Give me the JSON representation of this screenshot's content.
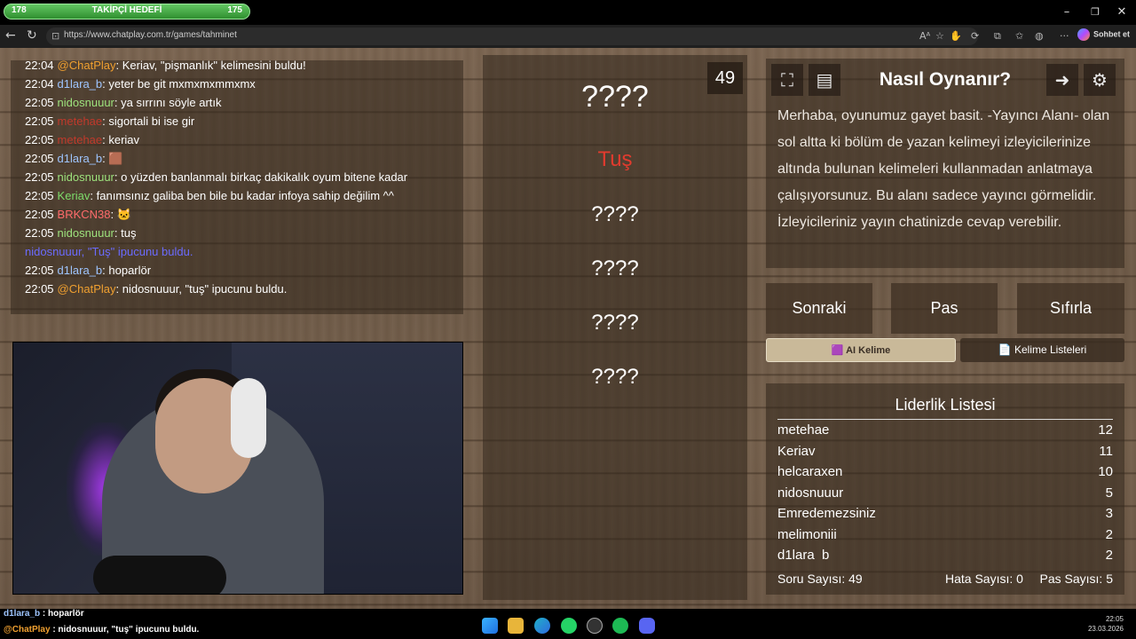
{
  "browser": {
    "url": "https://www.chatplay.com.tr/games/tahminet",
    "chat_button": "Sohbet et"
  },
  "goal": {
    "title": "TAKİPÇİ HEDEFİ",
    "current": "178",
    "target": "175",
    "progress_fraction": 1.0
  },
  "chat": {
    "messages": [
      {
        "time": "22:04",
        "user": "@ChatPlay",
        "user_color": "#f0a030",
        "text": ": Keriav, \"pişmanlık\" kelimesini buldu!"
      },
      {
        "time": "22:04",
        "user": "d1lara_b",
        "user_color": "#9ec5ff",
        "text": ": yeter be git mxmxmxmmxmx"
      },
      {
        "time": "22:05",
        "user": "nidosnuuur",
        "user_color": "#9ee37d",
        "text": ": ya sırrını söyle artık"
      },
      {
        "time": "22:05",
        "user": "metehae",
        "user_color": "#c0392b",
        "text": ": sigortali bi ise gir"
      },
      {
        "time": "22:05",
        "user": "metehae",
        "user_color": "#c0392b",
        "text": ": keriav"
      },
      {
        "time": "22:05",
        "user": "d1lara_b",
        "user_color": "#9ec5ff",
        "text": ": 🟫"
      },
      {
        "time": "22:05",
        "user": "nidosnuuur",
        "user_color": "#9ee37d",
        "text": ": o yüzden banlanmalı birkaç dakikalık oyum bitene kadar"
      },
      {
        "time": "22:05",
        "user": "Keriav",
        "user_color": "#7ddc6a",
        "text": ": fanımsınız galiba ben bile bu kadar infoya sahip değilim ^^"
      },
      {
        "time": "22:05",
        "user": "BRKCN38",
        "user_color": "#ff6b6b",
        "text": ": 🐱"
      },
      {
        "time": "22:05",
        "user": "nidosnuuur",
        "user_color": "#9ee37d",
        "text": ": tuş"
      },
      {
        "time": "",
        "user": "",
        "user_color": "#6b6bff",
        "text": "nidosnuuur, \"Tuş\" ipucunu buldu.",
        "system": true
      },
      {
        "time": "22:05",
        "user": "d1lara_b",
        "user_color": "#9ec5ff",
        "text": ": hoparlör"
      },
      {
        "time": "22:05",
        "user": "@ChatPlay",
        "user_color": "#f0a030",
        "text": ": nidosnuuur, \"tuş\" ipucunu buldu."
      }
    ]
  },
  "game": {
    "timer": "49",
    "main_word": "????",
    "hints": [
      "Tuş",
      "????",
      "????",
      "????",
      "????"
    ]
  },
  "help": {
    "title": "Nasıl Oynanır?",
    "text": "Merhaba, oyunumuz gayet basit. -Yayıncı Alanı- olan sol altta ki bölüm de yazan kelimeyi izleyicilerinize altında bulunan kelimeleri kullanmadan anlatmaya çalışıyorsunuz. Bu alanı sadece yayıncı görmelidir. İzleyicileriniz yayın chatinizde cevap verebilir.",
    "icons": [
      "fullscreen-icon",
      "notes-icon",
      "exit-icon",
      "settings-icon"
    ]
  },
  "actions": {
    "next": "Sonraki",
    "pass": "Pas",
    "reset": "Sıfırla",
    "ai_words": "🟪 AI Kelime",
    "word_lists": "📄 Kelime Listeleri"
  },
  "leaderboard": {
    "title": "Liderlik Listesi",
    "rows": [
      {
        "name": "metehae",
        "score": "12"
      },
      {
        "name": "Keriav",
        "score": "11"
      },
      {
        "name": "helcaraxen",
        "score": "10"
      },
      {
        "name": "nidosnuuur",
        "score": "5"
      },
      {
        "name": "Emredemezsiniz",
        "score": "3"
      },
      {
        "name": "melimoniii",
        "score": "2"
      },
      {
        "name": "d1lara_b",
        "score": "2"
      }
    ],
    "question_count": "Soru Sayısı: 49",
    "error_count": "Hata Sayısı: 0",
    "pass_count": "Pas Sayısı: 5"
  },
  "overlay_chat": [
    {
      "user": "d1lara_b",
      "text": " : hoparlör"
    },
    {
      "user": "@ChatPlay",
      "text": " : nidosnuuur, \"tuş\" ipucunu buldu."
    }
  ],
  "taskbar": {
    "time": "22:05",
    "date": "23.03.2026"
  }
}
